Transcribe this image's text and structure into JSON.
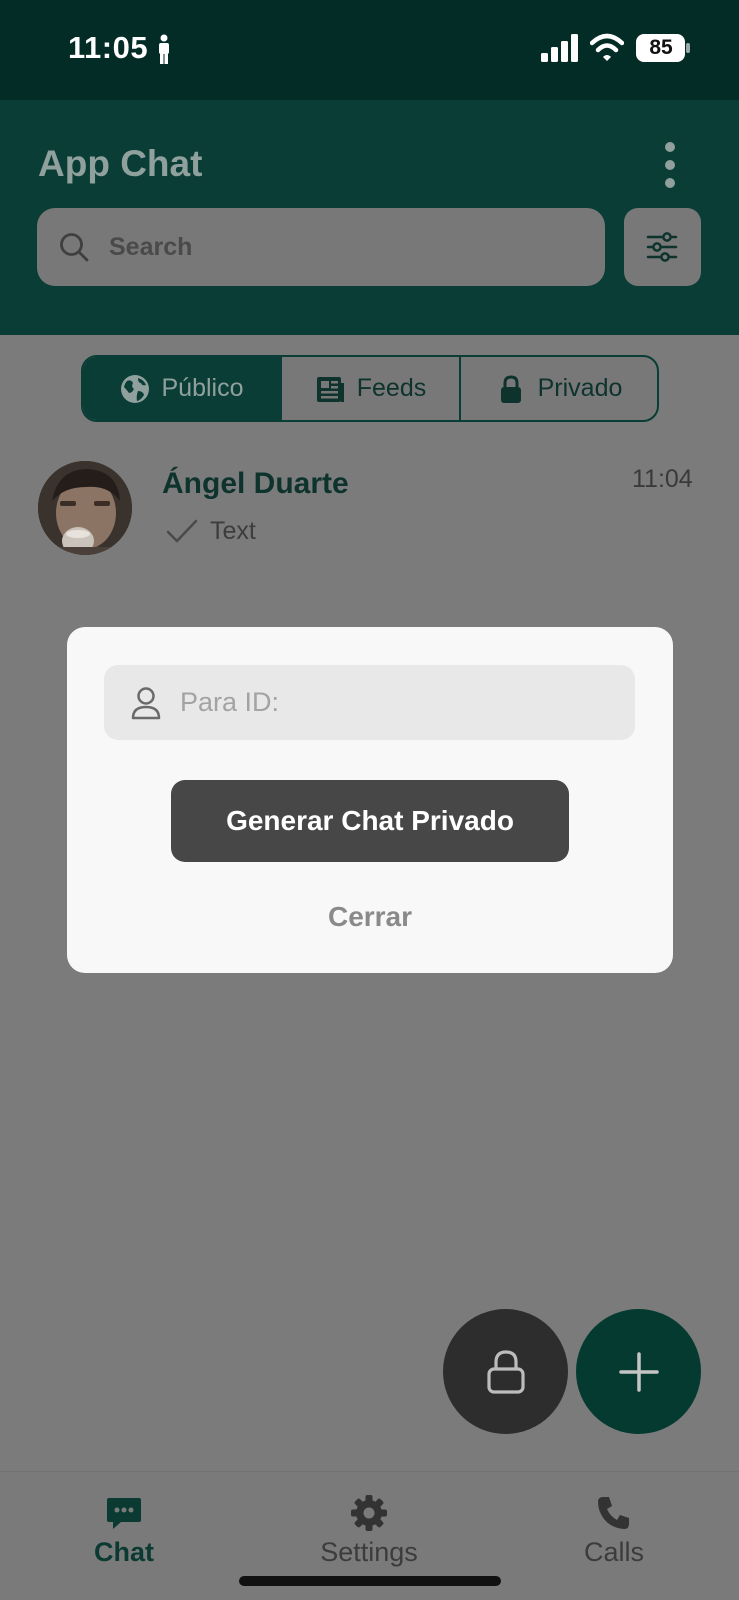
{
  "status_bar": {
    "time": "11:05",
    "battery": "85",
    "person_icon": "person-standing-icon",
    "signal_icon": "cellular-signal-icon",
    "wifi_icon": "wifi-icon",
    "battery_icon": "battery-icon"
  },
  "header": {
    "title": "App Chat",
    "search_placeholder": "Search",
    "menu_icon": "vertical-dots-icon",
    "filter_icon": "sliders-icon"
  },
  "segments": [
    {
      "label": "Público",
      "icon": "globe-icon",
      "active": true
    },
    {
      "label": "Feeds",
      "icon": "newspaper-icon",
      "active": false
    },
    {
      "label": "Privado",
      "icon": "lock-icon",
      "active": false
    }
  ],
  "chats": [
    {
      "name": "Ángel Duarte",
      "time": "11:04",
      "message": "Text",
      "status_icon": "checkmark-icon"
    }
  ],
  "modal": {
    "input_placeholder": "Para ID:",
    "input_value": "",
    "primary_button": "Generar Chat Privado",
    "close_button": "Cerrar"
  },
  "fabs": [
    {
      "icon": "lock-icon"
    },
    {
      "icon": "plus-icon"
    }
  ],
  "bottom_nav": [
    {
      "label": "Chat",
      "icon": "chat-bubble-icon",
      "active": true
    },
    {
      "label": "Settings",
      "icon": "gear-icon",
      "active": false
    },
    {
      "label": "Calls",
      "icon": "phone-icon",
      "active": false
    }
  ],
  "colors": {
    "header": "#093d35",
    "overlay": "#7b7b7b",
    "modal": "#f8f8f8",
    "button": "#474747",
    "accent": "#053a31"
  }
}
